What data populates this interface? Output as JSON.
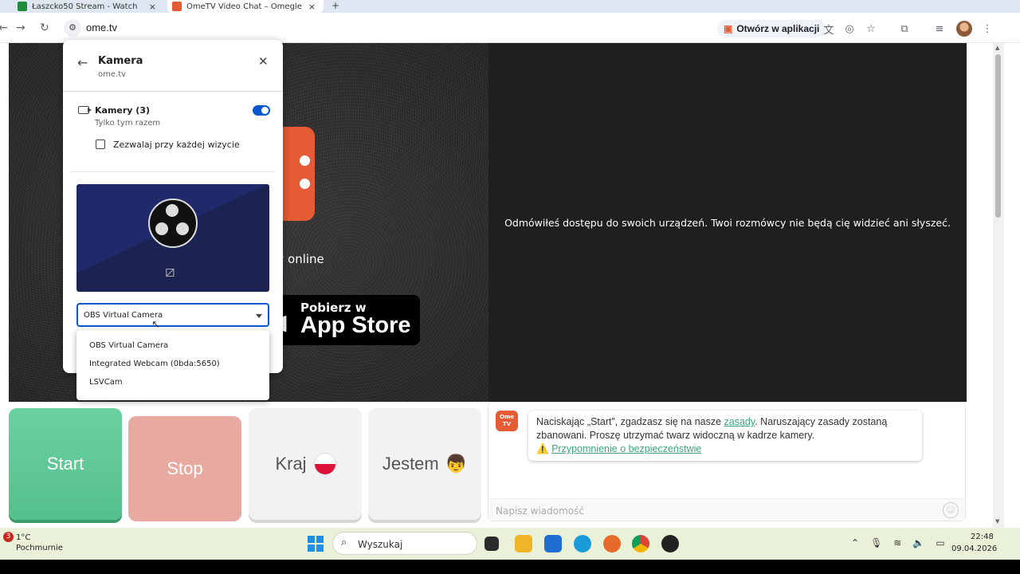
{
  "browser": {
    "tabs": [
      {
        "label": "Łaszcko50 Stream - Watch",
        "close": "×"
      },
      {
        "label": "OmeTV Video Chat – Omegle",
        "close": "×"
      }
    ],
    "new_tab": "+",
    "url": "ome.tv",
    "open_in_app": "Otwórz w aplikacji"
  },
  "page": {
    "refusal_text": "Odmówiłeś dostępu do swoich urządzeń. Twoi rozmówcy nie będą cię widzieć ani słyszeć.",
    "online_fragment": "w online",
    "app_store_small": "Pobierz w",
    "app_store_big": "App Store"
  },
  "permission_panel": {
    "title": "Kamera",
    "site": "ome.tv",
    "permission_label": "Kamery (3)",
    "permission_sub": "Tylko tym razem",
    "toggle_on": true,
    "checkbox_label": "Zezwalaj przy każdej wizycie",
    "selected_camera": "OBS Virtual Camera",
    "camera_options": [
      "OBS Virtual Camera",
      "Integrated Webcam (0bda:5650)",
      "LSVCam"
    ]
  },
  "controls": {
    "start": "Start",
    "stop": "Stop",
    "country": "Kraj",
    "gender": "Jestem"
  },
  "chat": {
    "badge": "Ome TV",
    "msg_part1": "Naciskając „Start”, zgadzasz się na nasze ",
    "rules_link": "zasady",
    "msg_part2": ". Naruszający zasady zostaną zbanowani. Proszę utrzymać twarz widoczną w kadrze kamery.",
    "warning_icon": "⚠️",
    "safety_link": "Przypomnienie o bezpieczeństwie",
    "input_placeholder": "Napisz wiadomość"
  },
  "taskbar": {
    "weather_badge": "3",
    "temperature": "1°C",
    "weather": "Pochmurnie",
    "search_placeholder": "Wyszukaj",
    "time": "22:48",
    "date": "09.04.2026"
  },
  "colors": {
    "accent": "#0b57d0",
    "start_green": "#5ec794",
    "stop_red": "#e8aaa0",
    "ome_orange": "#e55b33",
    "link_green": "#3aa879"
  }
}
